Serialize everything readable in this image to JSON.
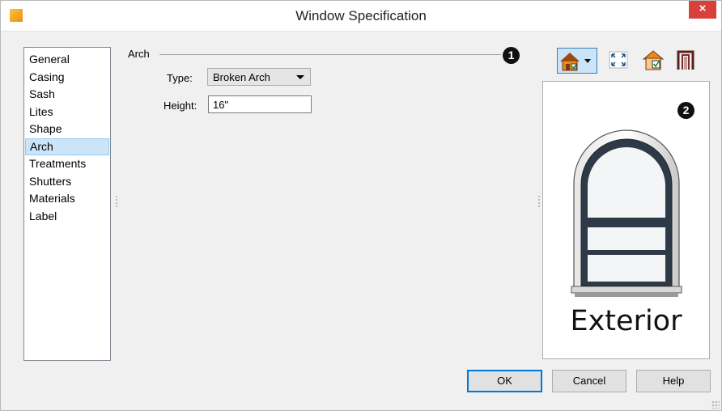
{
  "window": {
    "title": "Window Specification",
    "close_glyph": "×"
  },
  "nav": {
    "items": [
      {
        "label": "General"
      },
      {
        "label": "Casing"
      },
      {
        "label": "Sash"
      },
      {
        "label": "Lites"
      },
      {
        "label": "Shape"
      },
      {
        "label": "Arch",
        "selected": true
      },
      {
        "label": "Treatments"
      },
      {
        "label": "Shutters"
      },
      {
        "label": "Materials"
      },
      {
        "label": "Label"
      }
    ]
  },
  "arch": {
    "group_label": "Arch",
    "type_label": "Type:",
    "type_value": "Broken Arch",
    "height_label": "Height:",
    "height_value": "16\""
  },
  "callouts": {
    "one": "1",
    "two": "2"
  },
  "toolbar": {
    "icons": [
      "house-exterior-view-icon",
      "fit-view-icon",
      "interior-view-icon",
      "casing-view-icon"
    ]
  },
  "preview": {
    "label": "Exterior"
  },
  "buttons": {
    "ok": "OK",
    "cancel": "Cancel",
    "help": "Help"
  },
  "colors": {
    "selection": "#cce4f7",
    "close": "#d9403a",
    "default_button_border": "#0078d7",
    "window_frame": "#2e3a47"
  }
}
